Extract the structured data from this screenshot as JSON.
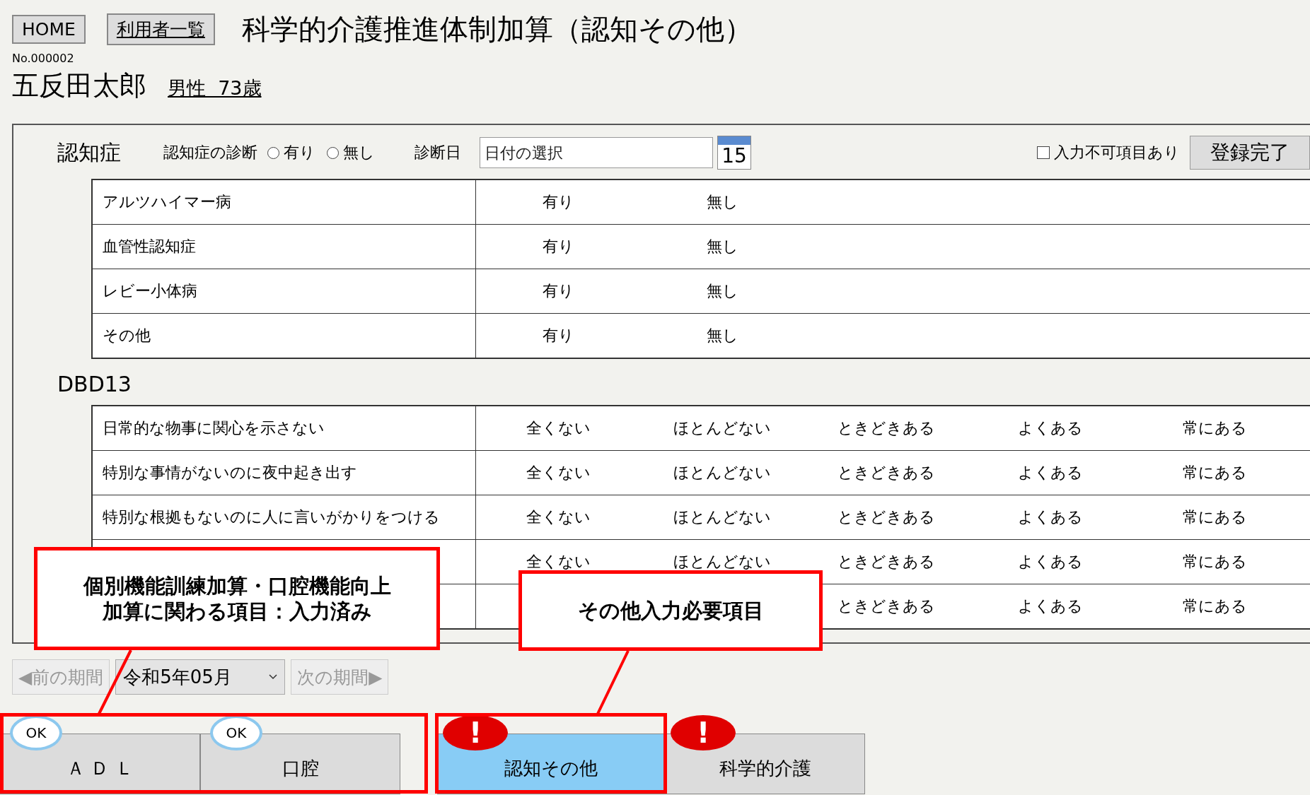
{
  "header": {
    "buttons": [
      "HOME",
      "利用者一覧"
    ],
    "title": "科学的介護推進体制加算（認知その他）"
  },
  "user": {
    "number": "No.000002",
    "name": "五反田太郎",
    "sex_age": "男性  73歳"
  },
  "dementia": {
    "heading": "認知症",
    "diagnosis_label": "認知症の診断",
    "diagnosis_options": [
      {
        "label": "有り",
        "selected": false
      },
      {
        "label": "無し",
        "selected": false
      }
    ],
    "date_label": "診断日",
    "date_field": {
      "placeholder": "日付の選択"
    },
    "calendar_day": "15",
    "unable_checkbox": {
      "label": "入力不可項目あり",
      "checked": false
    },
    "submit": "登録完了",
    "rows": [
      {
        "label": "アルツハイマー病",
        "options": [
          "有り",
          "無し"
        ]
      },
      {
        "label": "血管性認知症",
        "options": [
          "有り",
          "無し"
        ]
      },
      {
        "label": "レビー小体病",
        "options": [
          "有り",
          "無し"
        ]
      },
      {
        "label": "その他",
        "options": [
          "有り",
          "無し"
        ]
      }
    ]
  },
  "dbd13": {
    "heading": "DBD13",
    "rows": [
      {
        "label": "日常的な物事に関心を示さない",
        "options": [
          "全くない",
          "ほとんどない",
          "ときどきある",
          "よくある",
          "常にある"
        ]
      },
      {
        "label": "特別な事情がないのに夜中起き出す",
        "options": [
          "全くない",
          "ほとんどない",
          "ときどきある",
          "よくある",
          "常にある"
        ]
      },
      {
        "label": "特別な根拠もないのに人に言いがかりをつける",
        "options": [
          "全くない",
          "ほとんどない",
          "ときどきある",
          "よくある",
          "常にある"
        ]
      },
      {
        "options": [
          "全くない",
          "ほとんどない",
          "ときどきある",
          "よくある",
          "常にある"
        ]
      },
      {
        "options": [
          "ときどきある",
          "よくある",
          "常にある"
        ]
      }
    ]
  },
  "period": {
    "prev": {
      "label": "◀前の期間",
      "disabled": true
    },
    "month": "令和5年05月",
    "next": {
      "label": "次の期間▶",
      "disabled": true
    }
  },
  "tabs": [
    {
      "label": "Ａ Ｄ Ｌ",
      "selected": false,
      "kind": "ok",
      "badge": "OK"
    },
    {
      "label": "口腔",
      "selected": false,
      "kind": "ok",
      "badge": "OK"
    },
    {
      "label": "認知その他",
      "selected": true,
      "kind": "alert",
      "badge": "!"
    },
    {
      "label": "科学的介護",
      "selected": false,
      "kind": "alert",
      "badge": "!"
    }
  ],
  "callouts": [
    {
      "text": "個別機能訓練加算・口腔機能向上加算に関わる項目：入力済み"
    },
    {
      "text": "その他入力必要項目"
    }
  ]
}
